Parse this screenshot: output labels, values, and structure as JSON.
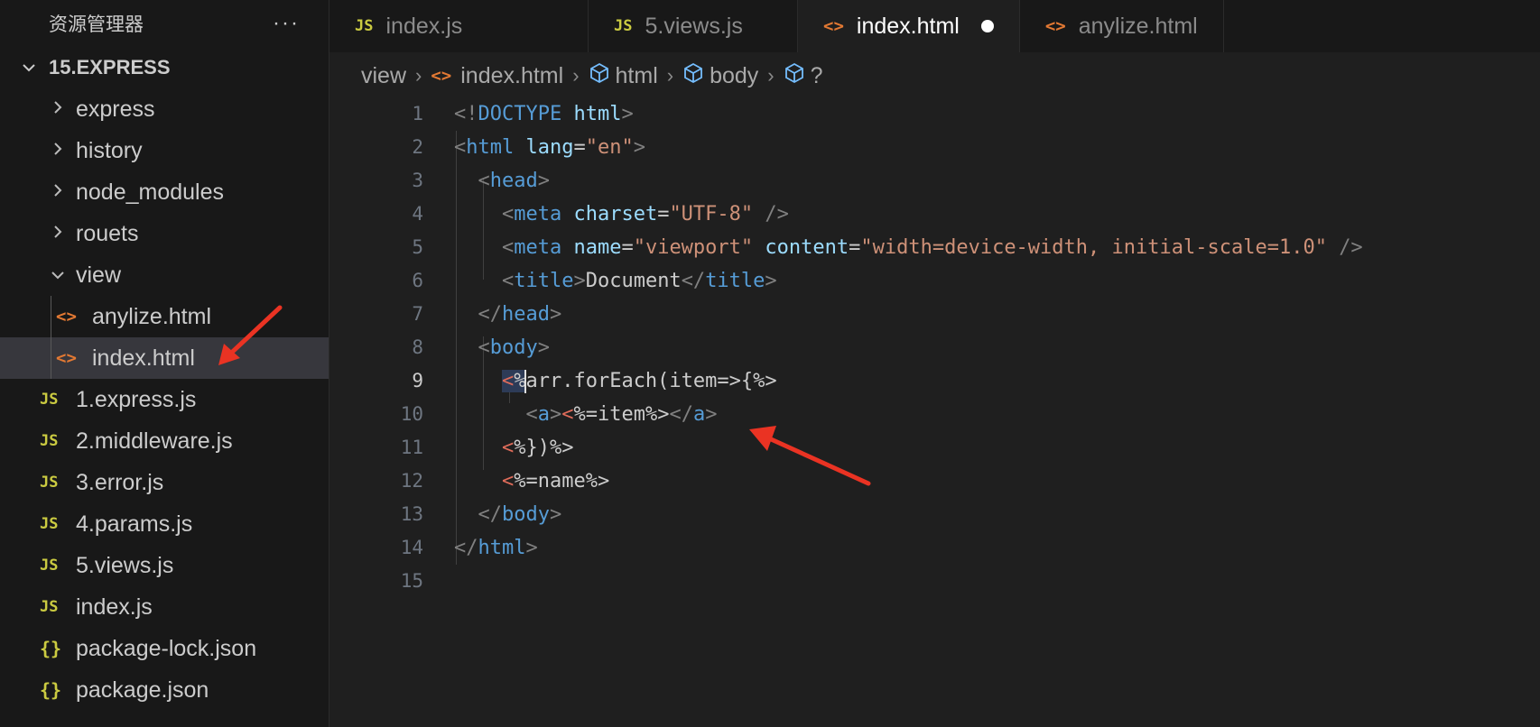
{
  "sidebar": {
    "title": "资源管理器",
    "more": "···",
    "root": "15.EXPRESS",
    "folders": [
      "express",
      "history",
      "node_modules",
      "rouets"
    ],
    "view_folder": "view",
    "view_files": [
      "anylize.html",
      "index.html"
    ],
    "files": [
      {
        "name": "1.express.js",
        "icon": "JS"
      },
      {
        "name": "2.middleware.js",
        "icon": "JS"
      },
      {
        "name": "3.error.js",
        "icon": "JS"
      },
      {
        "name": "4.params.js",
        "icon": "JS"
      },
      {
        "name": "5.views.js",
        "icon": "JS"
      },
      {
        "name": "index.js",
        "icon": "JS"
      },
      {
        "name": "package-lock.json",
        "icon": "{}"
      },
      {
        "name": "package.json",
        "icon": "{}"
      }
    ]
  },
  "tabs": [
    {
      "label": "index.js",
      "icon": "JS"
    },
    {
      "label": "5.views.js",
      "icon": "JS"
    },
    {
      "label": "index.html",
      "icon": "<>"
    },
    {
      "label": "anylize.html",
      "icon": "<>"
    }
  ],
  "breadcrumb": {
    "view": "view",
    "file": "index.html",
    "html": "html",
    "body": "body",
    "unknown": "?"
  },
  "editor": {
    "line_numbers": [
      "1",
      "2",
      "3",
      "4",
      "5",
      "6",
      "7",
      "8",
      "9",
      "10",
      "11",
      "12",
      "13",
      "14",
      "15"
    ],
    "current_line": 9
  },
  "colors": {
    "background": "#1f1f1f",
    "sidebar": "#181818",
    "tag": "#569cd6",
    "attribute": "#9cdcfe",
    "string": "#ce9178",
    "arrow": "#ea3323"
  }
}
